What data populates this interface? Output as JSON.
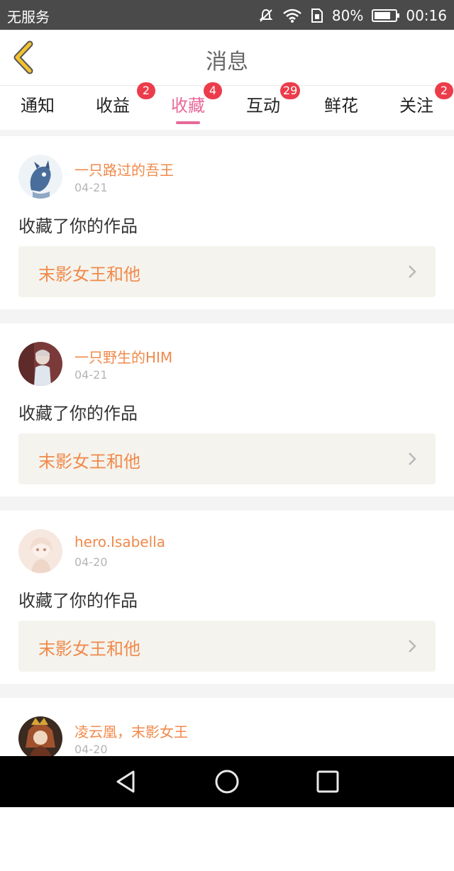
{
  "status_bar": {
    "carrier": "无服务",
    "battery": "80%",
    "battery_level": 0.8,
    "time": "00:16"
  },
  "header": {
    "title": "消息",
    "back_icon": "chevron-left-icon"
  },
  "tabs": [
    {
      "label": "通知",
      "badge": ""
    },
    {
      "label": "收益",
      "badge": "2"
    },
    {
      "label": "收藏",
      "badge": "4",
      "active": true
    },
    {
      "label": "互动",
      "badge": "29"
    },
    {
      "label": "鲜花",
      "badge": ""
    },
    {
      "label": "关注",
      "badge": "2"
    }
  ],
  "messages": [
    {
      "name": "一只路过的吾王",
      "date": "04-21",
      "action": "收藏了你的作品",
      "work": "末影女王和他"
    },
    {
      "name": "一只野生的HIM",
      "date": "04-21",
      "action": "收藏了你的作品",
      "work": "末影女王和他"
    },
    {
      "name": "hero.Isabella",
      "date": "04-20",
      "action": "收藏了你的作品",
      "work": "末影女王和他"
    },
    {
      "name": "凌云凰，末影女王",
      "date": "04-20",
      "action": "",
      "work": ""
    }
  ],
  "colors": {
    "accent_pink": "#e8699a",
    "name_orange": "#f08a4b",
    "badge_red": "#ec3c4b",
    "back_icon_yellow": "#f2c230"
  }
}
